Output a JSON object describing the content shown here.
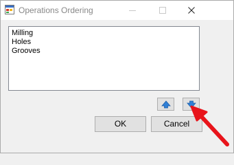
{
  "window": {
    "title": "Operations Ordering"
  },
  "list": {
    "items": [
      "Milling",
      "Holes",
      "Grooves"
    ]
  },
  "buttons": {
    "ok_label": "OK",
    "cancel_label": "Cancel"
  },
  "icons": {
    "app": "app-window-icon",
    "move_up": "arrow-up-icon",
    "move_down": "arrow-down-icon",
    "close": "close-icon"
  },
  "colors": {
    "arrow_blue": "#2f7fd6",
    "annotation_red": "#e8141b"
  }
}
